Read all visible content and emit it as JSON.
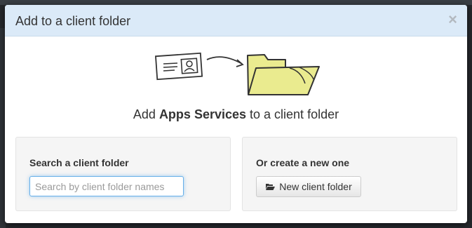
{
  "modal": {
    "title": "Add to a client folder",
    "close_symbol": "×",
    "message": {
      "prefix": "Add ",
      "entity": "Apps Services",
      "suffix": " to a client folder"
    }
  },
  "search_panel": {
    "heading": "Search a client folder",
    "input_placeholder": "Search by client folder names",
    "input_value": ""
  },
  "create_panel": {
    "heading": "Or create a new one",
    "button_label": "New client folder",
    "button_icon": "folder-open-icon"
  },
  "illustration": {
    "icons": [
      "contact-card-icon",
      "arrow-icon",
      "open-folder-icon"
    ]
  },
  "colors": {
    "header_bg": "#dbeaf8",
    "folder_fill": "#eaeb8f",
    "input_focus": "#66afe9"
  }
}
